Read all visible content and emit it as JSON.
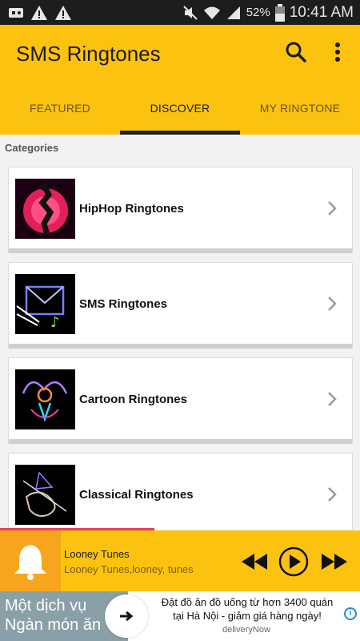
{
  "status_bar": {
    "battery": "52%",
    "time": "10:41 AM"
  },
  "app": {
    "title": "SMS Ringtones"
  },
  "tabs": [
    {
      "label": "FEATURED"
    },
    {
      "label": "DISCOVER"
    },
    {
      "label": "MY RINGTONE"
    }
  ],
  "content": {
    "section_label": "Categories",
    "categories": [
      {
        "label": "HipHop Ringtones"
      },
      {
        "label": "SMS Ringtones"
      },
      {
        "label": "Cartoon Ringtones"
      },
      {
        "label": "Classical Ringtones"
      }
    ]
  },
  "player": {
    "title": "Looney Tunes",
    "subtitle": "Looney Tunes,looney, tunes"
  },
  "ad": {
    "left_line1": "Một dịch vụ",
    "left_line2": "Ngàn món ăn",
    "right_line1": "Đặt đồ ăn đồ uống từ hơn 3400 quán",
    "right_line2": "tại Hà Nội - giảm giá hàng ngày!",
    "brand": "deliveryNow"
  },
  "colors": {
    "accent": "#fbc210",
    "accent_dark": "#f7a51e",
    "progress": "#e84060"
  }
}
